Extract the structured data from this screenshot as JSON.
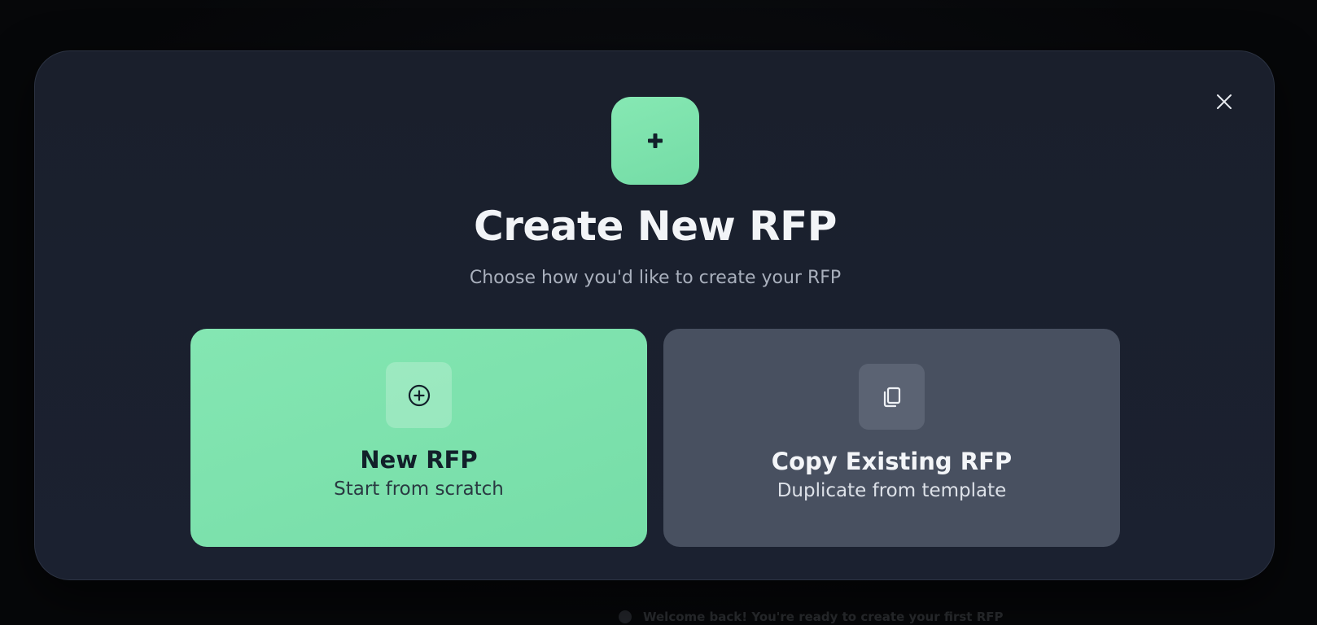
{
  "background": {
    "peek_text": "Welcome back! You're ready to create your first RFP"
  },
  "modal": {
    "title": "Create New RFP",
    "subtitle": "Choose how you'd like to create your RFP",
    "close_icon": "close-icon",
    "header_icon": "plus-icon",
    "accent_color": "#7ce3ad"
  },
  "options": {
    "new": {
      "title": "New RFP",
      "description": "Start from scratch",
      "icon": "plus-circle-icon"
    },
    "copy": {
      "title": "Copy Existing RFP",
      "description": "Duplicate from template",
      "icon": "copy-icon"
    }
  }
}
